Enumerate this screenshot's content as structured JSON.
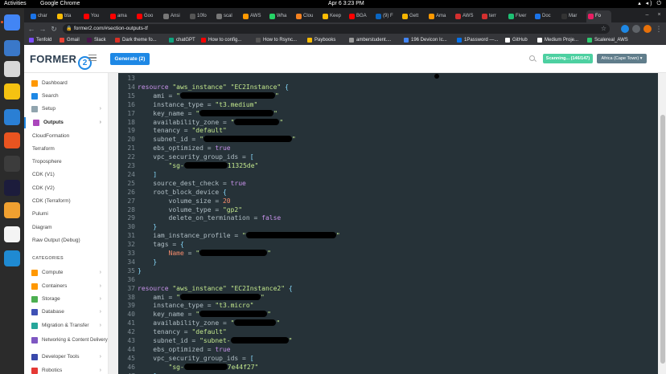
{
  "os": {
    "activities": "Activities",
    "app_name": "Google Chrome",
    "clock": "Apr 6  3:23 PM"
  },
  "browser": {
    "tabs": [
      {
        "label": "char",
        "color": "#1a73e8"
      },
      {
        "label": "bta",
        "color": "#fbbc04"
      },
      {
        "label": "You",
        "color": "#ff0000"
      },
      {
        "label": "ama",
        "color": "#ff0000"
      },
      {
        "label": "Goo",
        "color": "#ff0000"
      },
      {
        "label": "Ansi",
        "color": "#777777"
      },
      {
        "label": "10fo",
        "color": "#555555"
      },
      {
        "label": "scal",
        "color": "#777777"
      },
      {
        "label": "AWS",
        "color": "#ff9900"
      },
      {
        "label": "Wha",
        "color": "#25d366"
      },
      {
        "label": "Clou",
        "color": "#f48120"
      },
      {
        "label": "Keep",
        "color": "#fbbc04"
      },
      {
        "label": "BGA",
        "color": "#ff0000"
      },
      {
        "label": "(9) F",
        "color": "#0a66c2"
      },
      {
        "label": "Gett",
        "color": "#f4b400"
      },
      {
        "label": "Ama",
        "color": "#ff9900"
      },
      {
        "label": "AWS",
        "color": "#d32f2f"
      },
      {
        "label": "terr",
        "color": "#d32f2f"
      },
      {
        "label": "Fiver",
        "color": "#1dbf73"
      },
      {
        "label": "Doc",
        "color": "#1a73e8"
      },
      {
        "label": "Mar",
        "color": "#333333"
      },
      {
        "label": "Fo",
        "color": "#e91e63"
      }
    ],
    "url": "former2.com/#section-outputs-tf",
    "bookmarks": [
      {
        "label": "Tenfold",
        "color": "#7c4dff"
      },
      {
        "label": "Gmail",
        "color": "#ea4335"
      },
      {
        "label": "Slack",
        "color": "#4a154b"
      },
      {
        "label": "Dark theme fo...",
        "color": "#d93025"
      },
      {
        "label": "chatGPT",
        "color": "#10a37f"
      },
      {
        "label": "How to config...",
        "color": "#ff0000"
      },
      {
        "label": "How to Rsync...",
        "color": "#555555"
      },
      {
        "label": "Paybooks",
        "color": "#fbbc04"
      },
      {
        "label": "amberstudent....",
        "color": "#999999"
      },
      {
        "label": "196 Devicon Ic...",
        "color": "#4285f4"
      },
      {
        "label": "1Password —...",
        "color": "#0572ec"
      },
      {
        "label": "GitHub",
        "color": "#ffffff"
      },
      {
        "label": "Medium Proje...",
        "color": "#ffffff"
      },
      {
        "label": "Scalereal_AWS",
        "color": "#2ecc71"
      }
    ]
  },
  "app": {
    "logo_text": "FORMER",
    "logo_badge": "2",
    "generate_label": "Generate (2)",
    "scan_label": "Scanning... (146/147)",
    "region_label": "Africa (Cape Town) ▾"
  },
  "sidebar": {
    "items": [
      {
        "label": "Dashboard",
        "color": "#ff9800",
        "chevron": ""
      },
      {
        "label": "Search",
        "color": "#1e88e5",
        "chevron": ""
      },
      {
        "label": "Setup",
        "color": "#90a4ae",
        "chevron": "›"
      },
      {
        "label": "Outputs",
        "color": "#ab47bc",
        "chevron": "›"
      }
    ],
    "outputs": [
      "CloudFormation",
      "Terraform",
      "Troposphere",
      "CDK (V1)",
      "CDK (V2)",
      "CDK (Terraform)",
      "Pulumi",
      "Diagram",
      "Raw Output (Debug)"
    ],
    "categories_label": "CATEGORIES",
    "categories": [
      {
        "label": "Compute",
        "color": "#ff9800"
      },
      {
        "label": "Containers",
        "color": "#ff9800"
      },
      {
        "label": "Storage",
        "color": "#4caf50"
      },
      {
        "label": "Database",
        "color": "#3f51b5"
      },
      {
        "label": "Migration & Transfer",
        "color": "#26a69a"
      },
      {
        "label": "Networking & Content Delivery",
        "color": "#7e57c2"
      },
      {
        "label": "Developer Tools",
        "color": "#3949ab"
      },
      {
        "label": "Robotics",
        "color": "#e53935"
      }
    ]
  },
  "code_lines": [
    {
      "n": "13",
      "html": ""
    },
    {
      "n": "14",
      "html": "<span class='kw'>resource</span> <span class='str'>\"aws_instance\"</span> <span class='str'>\"EC2Instance\"</span> <span class='br'>{</span>"
    },
    {
      "n": "15",
      "html": "    ami = <span class='str'>\"</span><span class='redact' style='width:118px'></span><span class='str'>\"</span>"
    },
    {
      "n": "16",
      "html": "    instance_type = <span class='str'>\"t3.medium\"</span>"
    },
    {
      "n": "17",
      "html": "    key_name = <span class='str'>\"</span><span class='redact' style='width:92px'></span><span class='str'>\"</span>"
    },
    {
      "n": "18",
      "html": "    availability_zone = <span class='str'>\"</span><span class='redact' style='width:56px'></span><span class='str'>\"</span>"
    },
    {
      "n": "19",
      "html": "    tenancy = <span class='str'>\"default\"</span>"
    },
    {
      "n": "20",
      "html": "    subnet_id = <span class='str'>\"</span><span class='redact' style='width:110px'></span><span class='str'>\"</span>"
    },
    {
      "n": "21",
      "html": "    ebs_optimized = <span class='kw'>true</span>"
    },
    {
      "n": "22",
      "html": "    vpc_security_group_ids = <span class='br'>[</span>"
    },
    {
      "n": "23",
      "html": "        <span class='str'>\"sg-</span><span class='redact' style='width:54px'></span><span class='str'>11325de\"</span>"
    },
    {
      "n": "24",
      "html": "    <span class='br'>]</span>"
    },
    {
      "n": "25",
      "html": "    source_dest_check = <span class='kw'>true</span>"
    },
    {
      "n": "26",
      "html": "    root_block_device <span class='br'>{</span>"
    },
    {
      "n": "27",
      "html": "        volume_size = <span class='num'>20</span>"
    },
    {
      "n": "28",
      "html": "        volume_type = <span class='str'>\"gp2\"</span>"
    },
    {
      "n": "29",
      "html": "        delete_on_termination = <span class='kw'>false</span>"
    },
    {
      "n": "30",
      "html": "    <span class='br'>}</span>"
    },
    {
      "n": "31",
      "html": "    iam_instance_profile = <span class='str'>\"</span><span class='redact' style='width:112px'></span><span class='str'>\"</span>"
    },
    {
      "n": "32",
      "html": "    tags = <span class='br'>{</span>"
    },
    {
      "n": "33",
      "html": "        <span class='num'>Name</span> = <span class='str'>\"</span><span class='redact' style='width:84px'></span><span class='str'>\"</span>"
    },
    {
      "n": "34",
      "html": "    <span class='br'>}</span>"
    },
    {
      "n": "35",
      "html": "<span class='br'>}</span>"
    },
    {
      "n": "36",
      "html": ""
    },
    {
      "n": "37",
      "html": "<span class='kw'>resource</span> <span class='str'>\"aws_instance\"</span> <span class='str'>\"EC2Instance2\"</span> <span class='br'>{</span>"
    },
    {
      "n": "38",
      "html": "    ami = <span class='str'>\"</span><span class='redact' style='width:100px'></span><span class='str'>\"</span>"
    },
    {
      "n": "39",
      "html": "    instance_type = <span class='str'>\"t3.micro\"</span>"
    },
    {
      "n": "40",
      "html": "    key_name = <span class='str'>\"</span><span class='redact' style='width:84px'></span><span class='str'>\"</span>"
    },
    {
      "n": "41",
      "html": "    availability_zone = <span class='str'>\"</span><span class='redact' style='width:52px'></span><span class='str'>\"</span>"
    },
    {
      "n": "42",
      "html": "    tenancy = <span class='str'>\"default\"</span>"
    },
    {
      "n": "43",
      "html": "    subnet_id = <span class='str'>\"subnet-</span><span class='redact' style='width:72px'></span><span class='str'>\"</span>"
    },
    {
      "n": "44",
      "html": "    ebs_optimized = <span class='kw'>true</span>"
    },
    {
      "n": "45",
      "html": "    vpc_security_group_ids = <span class='br'>[</span>"
    },
    {
      "n": "46",
      "html": "        <span class='str'>\"sg-</span><span class='redact' style='width:54px'></span><span class='str'>7e44f27\"</span>"
    },
    {
      "n": "47",
      "html": "    <span class='br'>]</span>"
    }
  ],
  "dock_icons": [
    {
      "name": "chrome-icon",
      "color": "#4285f4"
    },
    {
      "name": "thunderbird-icon",
      "color": "#3a78c9"
    },
    {
      "name": "files-icon",
      "color": "#d8d8d8"
    },
    {
      "name": "rhythmbox-icon",
      "color": "#f5c211"
    },
    {
      "name": "libreoffice-writer-icon",
      "color": "#2a7fd4"
    },
    {
      "name": "app-center-icon",
      "color": "#e95420"
    },
    {
      "name": "terminal-icon",
      "color": "#3c3c3c"
    },
    {
      "name": "intellij-icon",
      "color": "#1c1c3c"
    },
    {
      "name": "sublime-icon",
      "color": "#f0a030"
    },
    {
      "name": "text-editor-icon",
      "color": "#f4f4f4"
    },
    {
      "name": "vscode-icon",
      "color": "#1f8ad2"
    }
  ]
}
